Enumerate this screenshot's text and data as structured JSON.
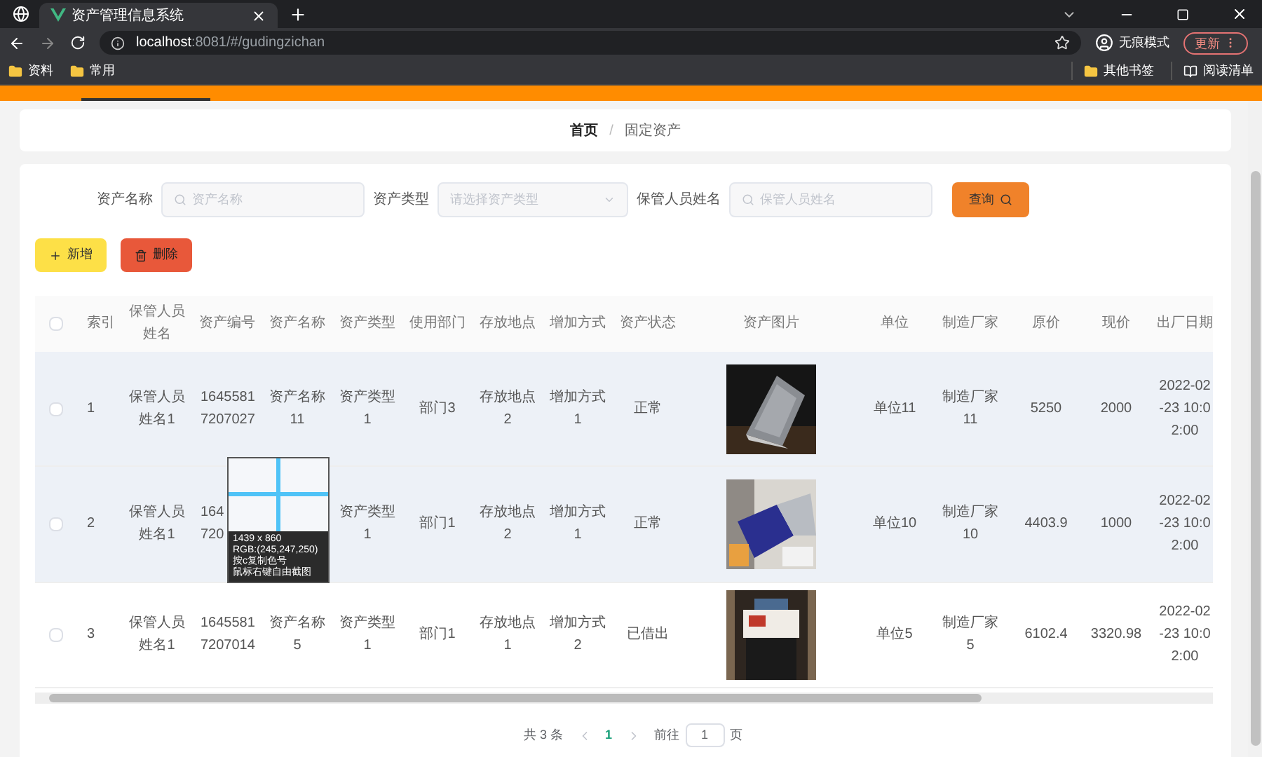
{
  "browser": {
    "tab_title": "资产管理信息系统",
    "url_host": "localhost",
    "url_rest": ":8081/#/gudingzichan",
    "incognito_label": "无痕模式",
    "update_button": "更新",
    "bookmarks": [
      "资料",
      "常用"
    ],
    "right_bookmarks": [
      "其他书签"
    ],
    "reading_list": "阅读清单"
  },
  "breadcrumb": {
    "items": [
      {
        "label": "首页",
        "selected": false
      },
      {
        "label": "固定资产",
        "selected": true
      }
    ],
    "separator": "/"
  },
  "search": {
    "fields": [
      {
        "kind": "input",
        "label": "资产名称",
        "placeholder": "资产名称"
      },
      {
        "kind": "select",
        "label": "资产类型",
        "placeholder": "请选择资产类型"
      },
      {
        "kind": "input",
        "label": "保管人员姓名",
        "placeholder": "保管人员姓名"
      }
    ],
    "button": "查询"
  },
  "actions": [
    {
      "kind": "add",
      "label": "新增"
    },
    {
      "kind": "delete",
      "label": "删除"
    }
  ],
  "table": {
    "all_checked": false,
    "columns": [
      "索引",
      "保管人员姓名",
      "资产编号",
      "资产名称",
      "资产类型",
      "使用部门",
      "存放地点",
      "增加方式",
      "资产状态",
      "资产图片",
      "单位",
      "制造厂家",
      "原价",
      "现价",
      "出厂日期"
    ],
    "rows": [
      {
        "highlighted": true,
        "checked": false,
        "cells": [
          [
            "1"
          ],
          [
            "保管人员",
            "姓名1"
          ],
          [
            "1645581",
            "7207027"
          ],
          [
            "资产名称",
            "11"
          ],
          [
            "资产类型",
            "1"
          ],
          [
            "部门3"
          ],
          [
            "存放地点",
            "2"
          ],
          [
            "增加方式",
            "1"
          ],
          [
            "正常"
          ],
          {
            "kind": "picture"
          },
          [
            "单位11"
          ],
          [
            "制造厂家",
            "11"
          ],
          [
            "5250"
          ],
          [
            "2000"
          ],
          [
            "2022-02",
            "-23 10:0",
            "2:00"
          ]
        ]
      },
      {
        "highlighted": true,
        "checked": false,
        "cells": [
          [
            "2"
          ],
          [
            "保管人员",
            "姓名1"
          ],
          [
            "164",
            "720"
          ],
          null,
          [
            "资产类型",
            "1"
          ],
          [
            "部门1"
          ],
          [
            "存放地点",
            "2"
          ],
          [
            "增加方式",
            "1"
          ],
          [
            "正常"
          ],
          {
            "kind": "picture"
          },
          [
            "单位10"
          ],
          [
            "制造厂家",
            "10"
          ],
          [
            "4403.9"
          ],
          [
            "1000"
          ],
          [
            "2022-02",
            "-23 10:0",
            "2:00"
          ]
        ]
      },
      {
        "highlighted": false,
        "checked": false,
        "cells": [
          [
            "3"
          ],
          [
            "保管人员",
            "姓名1"
          ],
          [
            "1645581",
            "7207014"
          ],
          [
            "资产名称",
            "5"
          ],
          [
            "资产类型",
            "1"
          ],
          [
            "部门1"
          ],
          [
            "存放地点",
            "1"
          ],
          [
            "增加方式",
            "2"
          ],
          [
            "已借出"
          ],
          {
            "kind": "picture"
          },
          [
            "单位5"
          ],
          [
            "制造厂家",
            "5"
          ],
          [
            "6102.4"
          ],
          [
            "3320.98"
          ],
          [
            "2022-02",
            "-23 10:0",
            "2:00"
          ]
        ]
      }
    ]
  },
  "pagination": {
    "total": "共 3 条",
    "pages": [
      {
        "label": "1",
        "selected": true
      }
    ],
    "goto_label": "前往",
    "goto_value": "1",
    "goto_suffix": "页"
  },
  "capture_overlay": {
    "size": "1439 x 860",
    "rgb": "RGB:(245,247,250)",
    "hints": [
      "按c复制色号",
      "鼠标右键自由截图"
    ]
  }
}
